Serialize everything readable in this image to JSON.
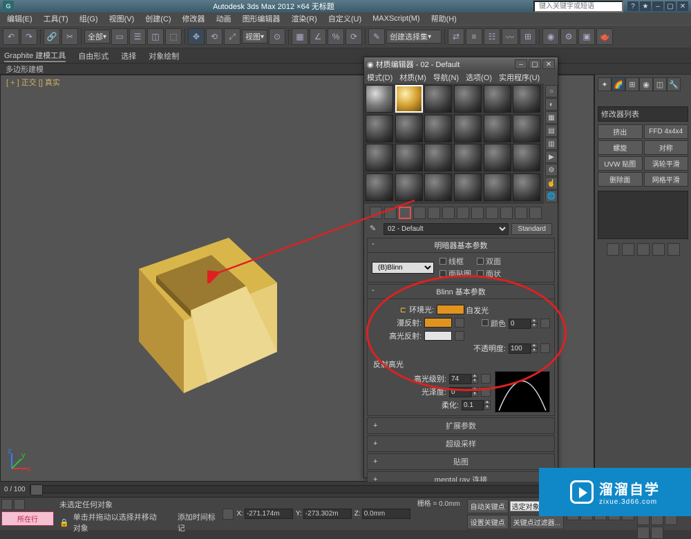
{
  "titlebar": {
    "appname": "Autodesk 3ds Max 2012 ×64   无标题",
    "search_placeholder": "键入关键字或短语"
  },
  "menubar": {
    "items": [
      "编辑(E)",
      "工具(T)",
      "组(G)",
      "视图(V)",
      "创建(C)",
      "修改器",
      "动画",
      "图形编辑器",
      "渲染(R)",
      "自定义(U)",
      "MAXScript(M)",
      "帮助(H)"
    ]
  },
  "toolbar": {
    "combo1": "全部",
    "combo2": "视图",
    "combo3": "创建选择集"
  },
  "ribbon": {
    "tabs": [
      "Graphite 建模工具",
      "自由形式",
      "选择",
      "对象绘制"
    ]
  },
  "subbar": {
    "label": "多边形建模"
  },
  "viewport": {
    "label": "[ + ] 正交 [] 真实"
  },
  "matedit": {
    "title": "材质编辑器 - 02 - Default",
    "menus": [
      "模式(D)",
      "材质(M)",
      "导航(N)",
      "选项(O)",
      "实用程序(U)"
    ],
    "matname": "02 - Default",
    "stdbtn": "Standard",
    "rollout_shader": "明暗器基本参数",
    "shader": "(B)Blinn",
    "cb_wire": "线框",
    "cb_2side": "双面",
    "cb_facemap": "面贴图",
    "cb_faceted": "面状",
    "rollout_blinn": "Blinn 基本参数",
    "lbl_selfillum": "自发光",
    "lbl_color": "颜色",
    "val_color": "0",
    "lbl_ambient": "环境光:",
    "lbl_diffuse": "漫反射:",
    "lbl_specular": "高光反射:",
    "lbl_opacity": "不透明度:",
    "val_opacity": "100",
    "lbl_spechi": "反射高光",
    "lbl_speclevel": "高光级别:",
    "val_speclevel": "74",
    "lbl_gloss": "光泽度:",
    "val_gloss": "0",
    "lbl_soften": "柔化:",
    "val_soften": "0.1",
    "coll1": "扩展参数",
    "coll2": "超级采样",
    "coll3": "贴图",
    "coll4": "mental ray 连接"
  },
  "rightpanel": {
    "combo": "修改器列表",
    "buttons": [
      "挤出",
      "FFD 4x4x4",
      "螺旋",
      "对称",
      "UVW 贴图",
      "涡轮平滑",
      "删除面",
      "网格平滑"
    ]
  },
  "timeline": {
    "pos": "0 / 100"
  },
  "status": {
    "pinkbtn": "所在行",
    "line1": "未选定任何对象",
    "line2": "单击并拖动以选择并移动对象",
    "addmarker": "添加时间标记",
    "x": "-271.174m",
    "y": "-273.302m",
    "z": "0.0mm",
    "grid": "栅格 = 0.0mm",
    "autokey": "自动关键点",
    "selected": "选定对象",
    "setkey": "设置关键点",
    "keyfilter": "关键点过滤器..."
  },
  "watermark": {
    "big": "溜溜自学",
    "small": "zixue.3d66.com"
  }
}
